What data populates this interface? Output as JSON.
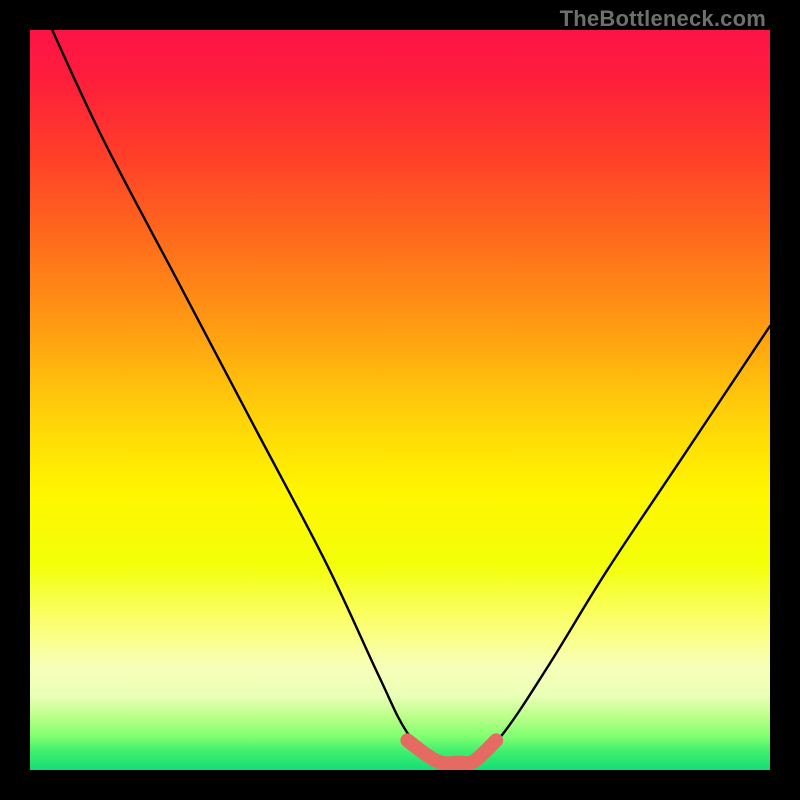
{
  "watermark": "TheBottleneck.com",
  "colors": {
    "frame": "#000000",
    "curve": "#000000",
    "marker": "#e46a62",
    "gradient_stops": [
      {
        "y": 0.0,
        "c": "#fd1347"
      },
      {
        "y": 0.07,
        "c": "#fe1f3b"
      },
      {
        "y": 0.16,
        "c": "#ff3b2a"
      },
      {
        "y": 0.28,
        "c": "#ff6a1c"
      },
      {
        "y": 0.4,
        "c": "#ff9b12"
      },
      {
        "y": 0.52,
        "c": "#ffd109"
      },
      {
        "y": 0.62,
        "c": "#fff500"
      },
      {
        "y": 0.72,
        "c": "#f3ff07"
      },
      {
        "y": 0.8,
        "c": "#fbff6f"
      },
      {
        "y": 0.86,
        "c": "#f8ffb8"
      },
      {
        "y": 0.9,
        "c": "#eaffb6"
      },
      {
        "y": 0.93,
        "c": "#b7ff87"
      },
      {
        "y": 0.955,
        "c": "#7fff70"
      },
      {
        "y": 0.975,
        "c": "#3fef6e"
      },
      {
        "y": 1.0,
        "c": "#15dd74"
      }
    ]
  },
  "chart_data": {
    "type": "line",
    "title": "",
    "xlabel": "",
    "ylabel": "",
    "xlim": [
      0,
      100
    ],
    "ylim": [
      0,
      100
    ],
    "grid": false,
    "legend": "none",
    "series": [
      {
        "name": "bottleneck-curve",
        "x": [
          3,
          10,
          20,
          30,
          40,
          47,
          51,
          55,
          58,
          60,
          64,
          70,
          78,
          88,
          100
        ],
        "y": [
          100,
          85,
          66,
          47,
          28,
          13,
          5,
          1,
          1,
          1,
          5,
          14,
          27,
          42,
          60
        ]
      }
    ],
    "flat_region": {
      "name": "optimal-band",
      "x": [
        51,
        55,
        58,
        60,
        63
      ],
      "y": [
        4,
        1.2,
        1,
        1.2,
        4
      ]
    }
  }
}
